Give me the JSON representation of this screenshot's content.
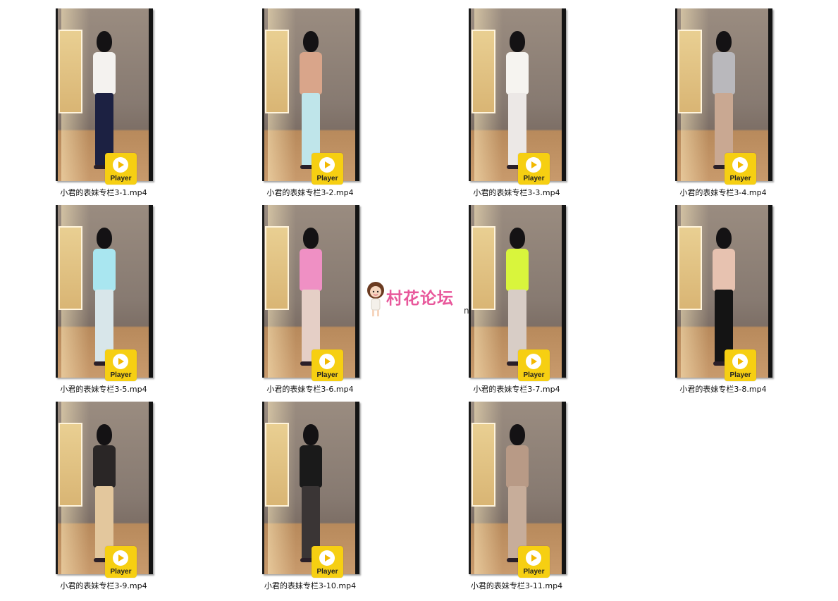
{
  "player_label": "Player",
  "watermark": {
    "text": "村花论坛",
    "fragment": "n"
  },
  "files": [
    {
      "name": "小君的表妹专栏3-1.mp4",
      "palette": {
        "torso": "#f4f2ef",
        "legs": "#1c2142"
      }
    },
    {
      "name": "小君的表妹专栏3-2.mp4",
      "palette": {
        "torso": "#d9a58a",
        "legs": "#bfe5ea"
      }
    },
    {
      "name": "小君的表妹专栏3-3.mp4",
      "palette": {
        "torso": "#f6f4f0",
        "legs": "#ece8e6"
      }
    },
    {
      "name": "小君的表妹专栏3-4.mp4",
      "palette": {
        "torso": "#b9b8bc",
        "legs": "#c9a892"
      }
    },
    {
      "name": "小君的表妹专栏3-5.mp4",
      "palette": {
        "torso": "#a9e6f0",
        "legs": "#d8e6ea"
      }
    },
    {
      "name": "小君的表妹专栏3-6.mp4",
      "palette": {
        "torso": "#ef90c4",
        "legs": "#e5cfc6"
      }
    },
    {
      "name": "小君的表妹专栏3-7.mp4",
      "palette": {
        "torso": "#d9f53c",
        "legs": "#d8cdc6"
      }
    },
    {
      "name": "小君的表妹专栏3-8.mp4",
      "palette": {
        "torso": "#e7c2b0",
        "legs": "#141414"
      }
    },
    {
      "name": "小君的表妹专栏3-9.mp4",
      "palette": {
        "torso": "#2a2626",
        "legs": "#e3c79d"
      }
    },
    {
      "name": "小君的表妹专栏3-10.mp4",
      "palette": {
        "torso": "#1a1a1a",
        "legs": "#3a3535"
      }
    },
    {
      "name": "小君的表妹专栏3-11.mp4",
      "palette": {
        "torso": "#b89a86",
        "legs": "#c7ad9a"
      }
    }
  ]
}
